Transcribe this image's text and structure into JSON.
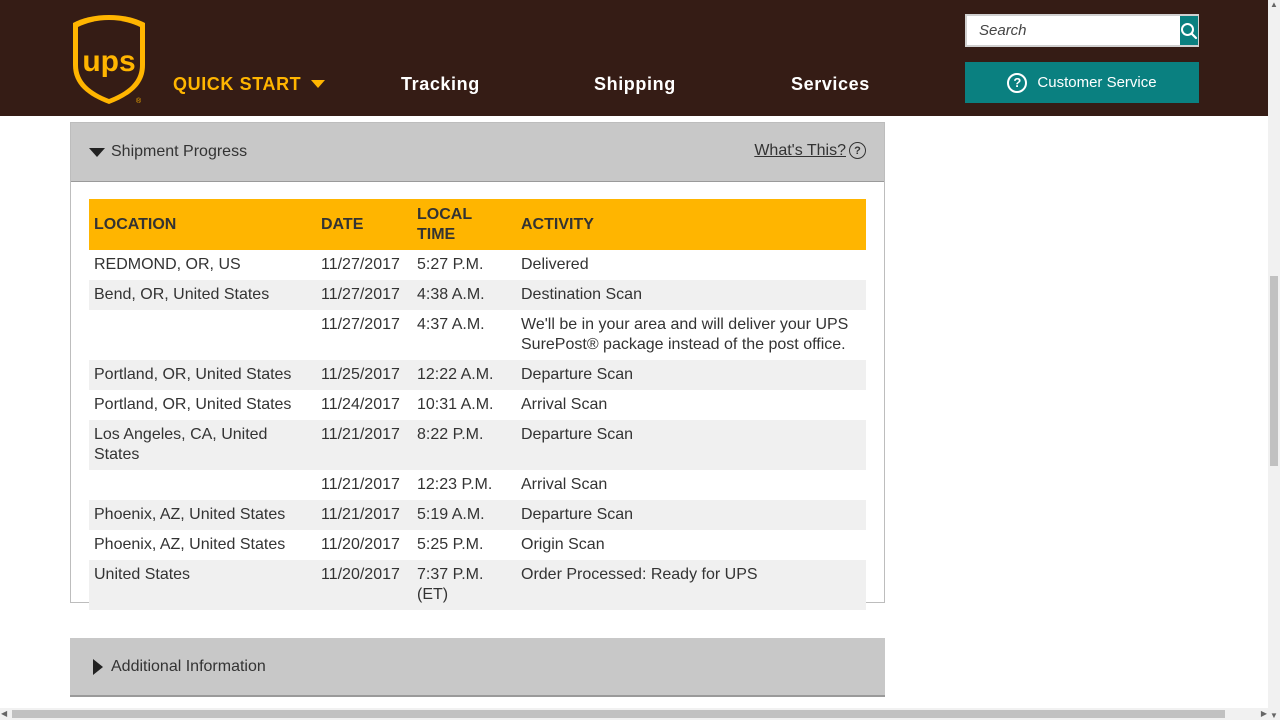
{
  "header": {
    "brand": "ups",
    "nav": {
      "quick_start": "QUICK START",
      "tracking": "Tracking",
      "shipping": "Shipping",
      "services": "Services"
    },
    "search": {
      "placeholder": "Search"
    },
    "customer_service": "Customer Service",
    "colors": {
      "background": "#351c15",
      "accent": "#ffb500",
      "teal": "#0a8080"
    }
  },
  "shipment_progress": {
    "title": "Shipment Progress",
    "whats_this": "What's This?",
    "columns": [
      "LOCATION",
      "DATE",
      "LOCAL TIME",
      "ACTIVITY"
    ],
    "rows": [
      {
        "location": "REDMOND,  OR,  US",
        "date": "11/27/2017",
        "time": "5:27 P.M.",
        "activity": "Delivered"
      },
      {
        "location": "Bend,  OR,  United States",
        "date": "11/27/2017",
        "time": "4:38 A.M.",
        "activity": "Destination Scan"
      },
      {
        "location": "",
        "date": "11/27/2017",
        "time": "4:37 A.M.",
        "activity": "We'll be in your area and will deliver your UPS SurePost® package instead of the post office."
      },
      {
        "location": "Portland,  OR,  United States",
        "date": "11/25/2017",
        "time": "12:22 A.M.",
        "activity": "Departure Scan"
      },
      {
        "location": "Portland,  OR,  United States",
        "date": "11/24/2017",
        "time": "10:31 A.M.",
        "activity": "Arrival Scan"
      },
      {
        "location": "Los Angeles,  CA,  United States",
        "date": "11/21/2017",
        "time": "8:22 P.M.",
        "activity": "Departure Scan"
      },
      {
        "location": "",
        "date": "11/21/2017",
        "time": "12:23 P.M.",
        "activity": "Arrival Scan"
      },
      {
        "location": "Phoenix,  AZ,  United States",
        "date": "11/21/2017",
        "time": "5:19 A.M.",
        "activity": "Departure Scan"
      },
      {
        "location": "Phoenix,  AZ,  United States",
        "date": "11/20/2017",
        "time": "5:25 P.M.",
        "activity": "Origin Scan"
      },
      {
        "location": "United States",
        "date": "11/20/2017",
        "time": "7:37 P.M. (ET)",
        "activity": "Order Processed: Ready for UPS"
      }
    ]
  },
  "additional_information": {
    "title": "Additional Information"
  }
}
